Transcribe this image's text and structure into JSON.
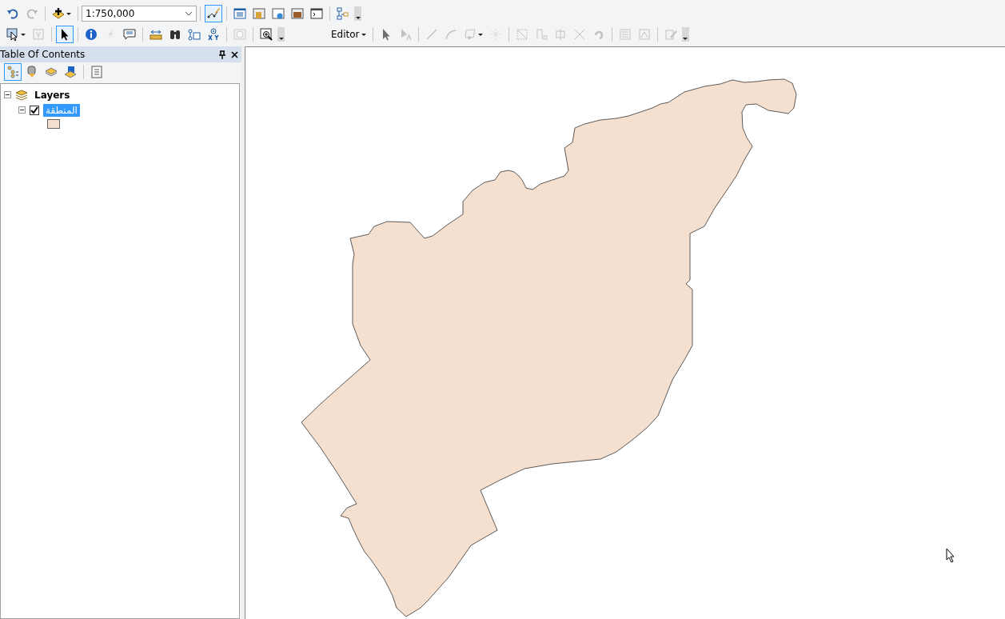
{
  "standard_toolbar": [
    {
      "kind": "button",
      "disabled": false,
      "selected": false
    },
    {
      "kind": "button",
      "disabled": true,
      "selected": false
    },
    {
      "kind": "separator"
    },
    {
      "kind": "button",
      "disabled": false,
      "selected": false
    },
    {
      "kind": "separator"
    },
    {
      "kind": "scale",
      "value": "1:750,000"
    },
    {
      "kind": "separator"
    },
    {
      "kind": "button",
      "disabled": false,
      "selected": true
    },
    {
      "kind": "separator"
    },
    {
      "kind": "button",
      "disabled": false,
      "selected": false
    },
    {
      "kind": "button",
      "disabled": false,
      "selected": false
    },
    {
      "kind": "button",
      "disabled": false,
      "selected": false
    },
    {
      "kind": "button",
      "disabled": false,
      "selected": false
    },
    {
      "kind": "button",
      "disabled": false,
      "selected": false
    },
    {
      "kind": "separator"
    },
    {
      "kind": "button",
      "disabled": false,
      "selected": false
    },
    {
      "kind": "overflow"
    }
  ],
  "tools_toolbar": [
    {
      "kind": "button",
      "disabled": false,
      "selected": false
    },
    {
      "kind": "button",
      "disabled": true,
      "selected": false
    },
    {
      "kind": "separator"
    },
    {
      "kind": "button",
      "disabled": false,
      "selected": true
    },
    {
      "kind": "separator"
    },
    {
      "kind": "button",
      "disabled": false,
      "selected": false
    },
    {
      "kind": "button",
      "disabled": true,
      "selected": false
    },
    {
      "kind": "button",
      "disabled": false,
      "selected": false
    },
    {
      "kind": "separator"
    },
    {
      "kind": "button",
      "disabled": false,
      "selected": false
    },
    {
      "kind": "button",
      "disabled": false,
      "selected": false
    },
    {
      "kind": "button",
      "disabled": false,
      "selected": false
    },
    {
      "kind": "button",
      "disabled": false,
      "selected": false
    },
    {
      "kind": "separator"
    },
    {
      "kind": "button",
      "disabled": true,
      "selected": false
    },
    {
      "kind": "separator"
    },
    {
      "kind": "button",
      "disabled": false,
      "selected": false
    },
    {
      "kind": "overflow"
    }
  ],
  "editor_toolbar": [
    {
      "kind": "menu",
      "label": "Editor"
    },
    {
      "kind": "separator"
    },
    {
      "kind": "button",
      "disabled": true,
      "selected": false
    },
    {
      "kind": "button",
      "disabled": true,
      "selected": false
    },
    {
      "kind": "separator"
    },
    {
      "kind": "button",
      "disabled": true,
      "selected": false
    },
    {
      "kind": "button",
      "disabled": true,
      "selected": false
    },
    {
      "kind": "button",
      "disabled": true,
      "selected": false
    },
    {
      "kind": "button",
      "disabled": true,
      "selected": false
    },
    {
      "kind": "separator"
    },
    {
      "kind": "button",
      "disabled": true,
      "selected": false
    },
    {
      "kind": "button",
      "disabled": true,
      "selected": false
    },
    {
      "kind": "button",
      "disabled": true,
      "selected": false
    },
    {
      "kind": "button",
      "disabled": true,
      "selected": false
    },
    {
      "kind": "button",
      "disabled": true,
      "selected": false
    },
    {
      "kind": "separator"
    },
    {
      "kind": "button",
      "disabled": true,
      "selected": false
    },
    {
      "kind": "button",
      "disabled": true,
      "selected": false
    },
    {
      "kind": "separator"
    },
    {
      "kind": "button",
      "disabled": true,
      "selected": false
    },
    {
      "kind": "overflow"
    }
  ],
  "table_of_contents": {
    "title": "Table Of Contents",
    "toolbar": [
      {
        "kind": "button",
        "disabled": false,
        "selected": true
      },
      {
        "kind": "button",
        "disabled": false,
        "selected": false
      },
      {
        "kind": "button",
        "disabled": false,
        "selected": false
      },
      {
        "kind": "button",
        "disabled": false,
        "selected": false
      },
      {
        "kind": "separator"
      },
      {
        "kind": "button",
        "disabled": false,
        "selected": false
      }
    ],
    "tree": [
      {
        "label": "Layers",
        "expanded": true,
        "children": [
          {
            "label": "المنطقة",
            "checked": true,
            "selected": true,
            "expanded": true
          }
        ]
      }
    ]
  }
}
